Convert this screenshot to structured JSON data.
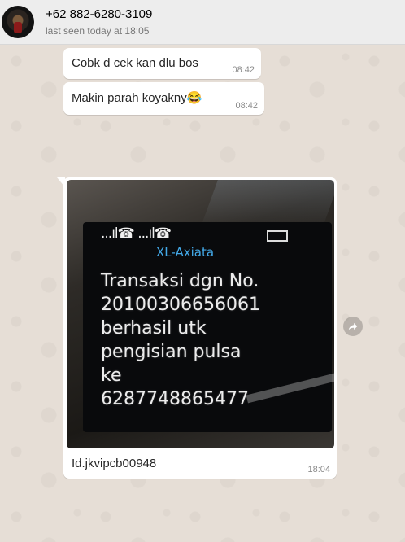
{
  "header": {
    "contact_name": "+62 882-6280-3109",
    "status": "last seen today at 18:05"
  },
  "messages": [
    {
      "text": "Cobk d cek kan dlu bos",
      "time": "08:42"
    },
    {
      "text": "Makin parah koyakny😂",
      "time": "08:42"
    },
    {
      "image": {
        "signal_text": "...ıl☎ ...ıl☎",
        "operator": "XL-Axiata",
        "sms_text": "Transaksi dgn No.\n20100306656061\nberhasil utk\npengisian pulsa\nke\n6287748865477"
      },
      "caption": "Id.jkvipcb00948",
      "time": "18:04"
    }
  ],
  "icons": {
    "forward": "forward-arrow-icon"
  },
  "colors": {
    "chat_bg": "#e6ded6",
    "header_bg": "#ededed",
    "bubble": "#ffffff",
    "operator_text": "#43a9e8"
  }
}
